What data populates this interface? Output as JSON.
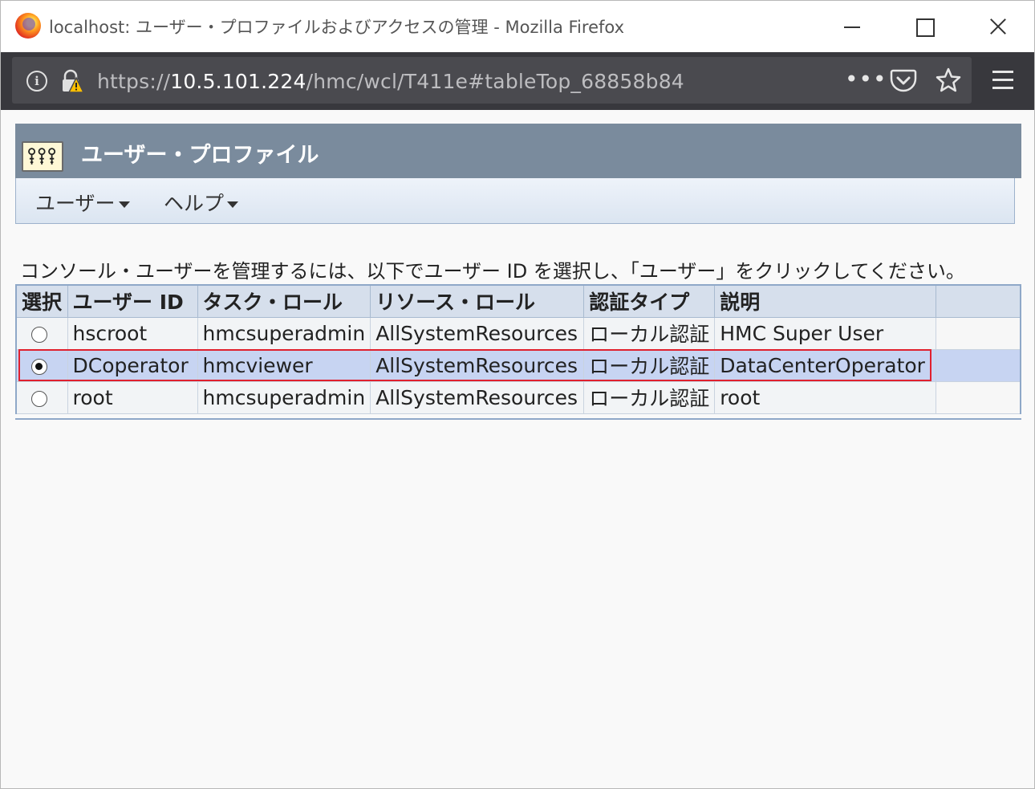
{
  "window": {
    "title": "localhost: ユーザー・プロファイルおよびアクセスの管理 - Mozilla Firefox"
  },
  "address_bar": {
    "url_scheme": "https://",
    "url_host": "10.5.101.224",
    "url_path": "/hmc/wcl/T411e#tableTop_68858b84",
    "more_label": "•••"
  },
  "portlet": {
    "title": "ユーザー・プロファイル"
  },
  "menu": {
    "users_label": "ユーザー",
    "help_label": "ヘルプ"
  },
  "instruction": "コンソール・ユーザーを管理するには、以下でユーザー ID を選択し、「ユーザー」をクリックしてください。",
  "table": {
    "columns": {
      "select": "選択",
      "user_id": "ユーザー ID",
      "task_role": "タスク・ロール",
      "resource_role": "リソース・ロール",
      "auth_type": "認証タイプ",
      "description": "説明"
    },
    "rows": [
      {
        "user_id": "hscroot",
        "task_role": "hmcsuperadmin",
        "resource_role": "AllSystemResources",
        "auth_type": "ローカル認証",
        "description": "HMC Super User",
        "selected": false
      },
      {
        "user_id": "DCoperator",
        "task_role": "hmcviewer",
        "resource_role": "AllSystemResources",
        "auth_type": "ローカル認証",
        "description": "DataCenterOperator",
        "selected": true
      },
      {
        "user_id": "root",
        "task_role": "hmcsuperadmin",
        "resource_role": "AllSystemResources",
        "auth_type": "ローカル認証",
        "description": "root",
        "selected": false
      }
    ]
  },
  "colors": {
    "header_bar": "#7a8b9d",
    "selected_row": "#c7d4f2",
    "highlight_border": "#e0202e",
    "browser_chrome": "#38383d"
  }
}
